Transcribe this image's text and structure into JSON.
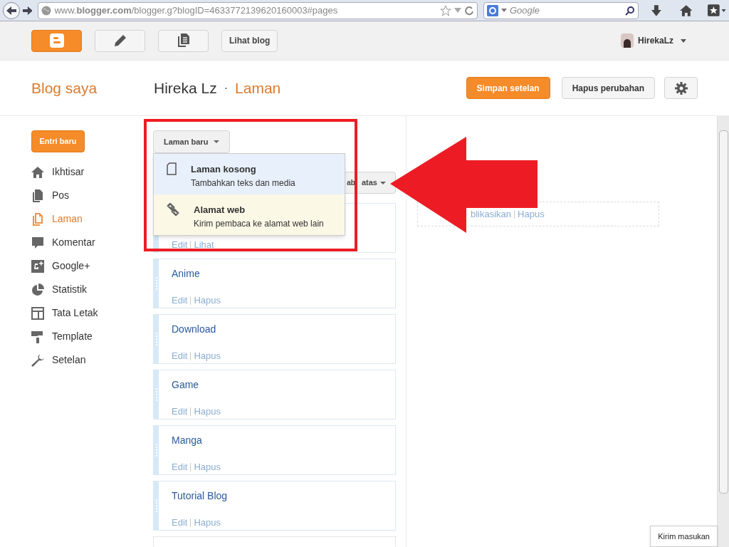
{
  "browser": {
    "url": "www.**blogger.com**/blogger.g?blogID=4633772139620160003#pages",
    "search_placeholder": "Google"
  },
  "topbar": {
    "buttons": [
      {
        "kind": "logo"
      },
      {
        "kind": "pencil"
      },
      {
        "kind": "pages"
      },
      {
        "kind": "text",
        "label": "Lihat blog"
      }
    ],
    "user": "HirekaLz"
  },
  "header": {
    "title": "Blog saya",
    "blog_name": "Hireka Lz",
    "separator": "·",
    "section": "Laman",
    "buttons": [
      {
        "kind": "primary",
        "label": "Simpan setelan"
      },
      {
        "kind": "secondary",
        "label": "Hapus perubahan"
      }
    ]
  },
  "sidebar": {
    "new_post": "Entri baru",
    "items": [
      {
        "kind": "home",
        "label": "Ikhtisar",
        "selected": false
      },
      {
        "kind": "posts",
        "label": "Pos",
        "selected": false
      },
      {
        "kind": "pages",
        "label": "Laman",
        "selected": true
      },
      {
        "kind": "comment",
        "label": "Komentar",
        "selected": false
      },
      {
        "kind": "gplus",
        "label": "Google+",
        "selected": false
      },
      {
        "kind": "pie",
        "label": "Statistik",
        "selected": false
      },
      {
        "kind": "layout",
        "label": "Tata Letak",
        "selected": false
      },
      {
        "kind": "roller",
        "label": "Template",
        "selected": false
      },
      {
        "kind": "wrench",
        "label": "Setelan",
        "selected": false
      }
    ]
  },
  "new_page_button": "Laman baru",
  "menu": [
    {
      "kind": "page",
      "title": "Laman kosong",
      "subtitle": "Tambahkan teks dan media",
      "selected": true
    },
    {
      "kind": "link",
      "title": "Alamat web",
      "subtitle": "Kirim pembaca ke alamat web lain",
      "selected": false
    }
  ],
  "tabs_button": [
    "ab",
    "atas"
  ],
  "pages": [
    {
      "links": [
        "Edit",
        "Lihat"
      ]
    },
    {
      "title": "Anime",
      "links": [
        "Edit",
        "Hapus"
      ]
    },
    {
      "title": "Download",
      "links": [
        "Edit",
        "Hapus"
      ]
    },
    {
      "title": "Game",
      "links": [
        "Edit",
        "Hapus"
      ]
    },
    {
      "title": "Manga",
      "links": [
        "Edit",
        "Hapus"
      ]
    },
    {
      "title": "Tutorial Blog",
      "links": [
        "Edit",
        "Hapus"
      ]
    }
  ],
  "draft": {
    "links": [
      "blikasikan",
      "Hapus"
    ]
  },
  "feedback": "Kirim masukan"
}
